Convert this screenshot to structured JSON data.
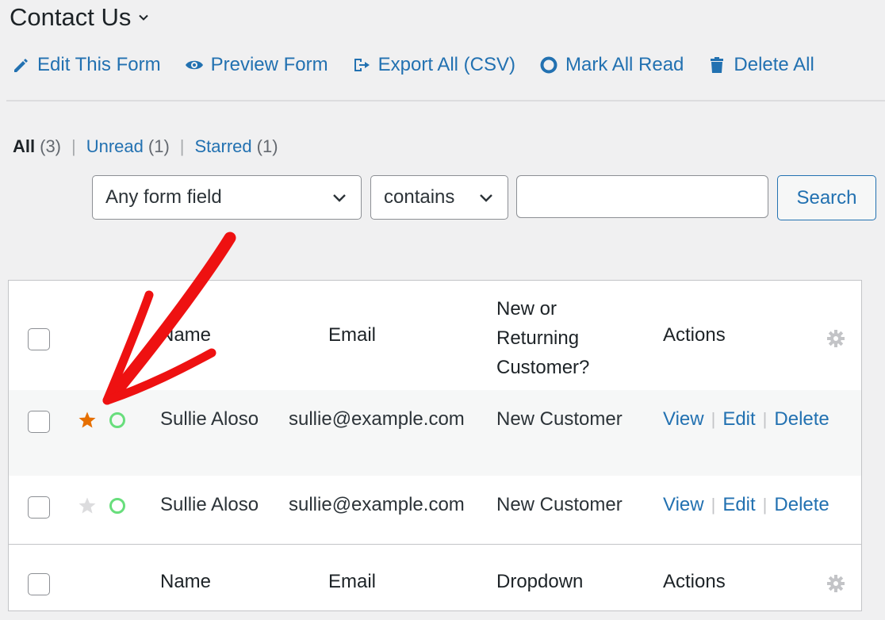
{
  "header": {
    "title": "Contact Us"
  },
  "toolbar": {
    "edit_form": "Edit This Form",
    "preview_form": "Preview Form",
    "export_all": "Export All (CSV)",
    "mark_all_read": "Mark All Read",
    "delete_all": "Delete All"
  },
  "views": {
    "all_label": "All",
    "all_count": "(3)",
    "unread_label": "Unread",
    "unread_count": "(1)",
    "starred_label": "Starred",
    "starred_count": "(1)",
    "separator": "|"
  },
  "filter": {
    "field_value": "Any form field",
    "operator_value": "contains",
    "search_value": "",
    "search_button": "Search"
  },
  "table": {
    "columns": {
      "name": "Name",
      "email": "Email",
      "customer_line1": "New or",
      "customer_line2": "Returning",
      "customer_line3": "Customer?",
      "actions": "Actions"
    },
    "footer_columns": {
      "name": "Name",
      "email": "Email",
      "customer": "Dropdown",
      "actions": "Actions"
    },
    "rows": [
      {
        "starred": true,
        "name": "Sullie Aloso",
        "email": "sullie@example.com",
        "customer": "New Customer"
      },
      {
        "starred": false,
        "name": "Sullie Aloso",
        "email": "sullie@example.com",
        "customer": "New Customer"
      }
    ],
    "row_actions": {
      "view": "View",
      "edit": "Edit",
      "delete": "Delete",
      "separator": "|"
    }
  },
  "colors": {
    "link": "#2271b1",
    "star_active": "#e66f00",
    "star_inactive": "#dcdcde",
    "read_ring": "#68de7c",
    "annotation_arrow": "#ee1111"
  },
  "icons": {
    "toolbar": [
      "pencil-icon",
      "eye-icon",
      "export-icon",
      "circle-icon",
      "trash-icon"
    ],
    "row": [
      "star-icon",
      "read-status-icon"
    ],
    "column_settings": "gear-icon"
  }
}
